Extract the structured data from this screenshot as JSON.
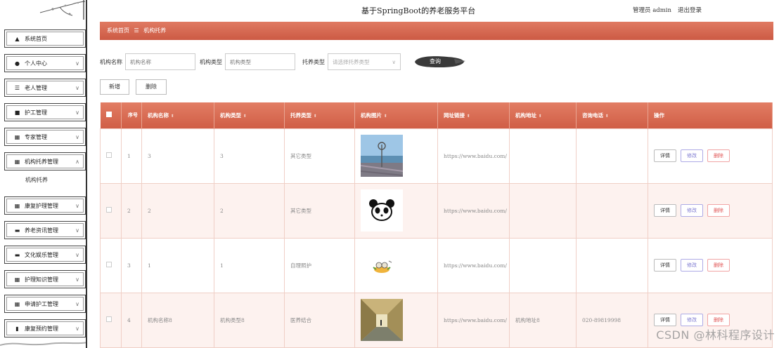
{
  "header": {
    "title": "基于SpringBoot的养老服务平台",
    "user": "管理员 admin",
    "logout": "退出登录"
  },
  "breadcrumb": {
    "home": "系统首页",
    "sep": "☰",
    "current": "机构托养"
  },
  "sidebar": {
    "items": [
      {
        "label": "系统首页",
        "icon": "home-icon",
        "chev": false
      },
      {
        "label": "个人中心",
        "icon": "user-icon",
        "chev": true
      },
      {
        "label": "老人管理",
        "icon": "list-icon",
        "chev": true
      },
      {
        "label": "护工管理",
        "icon": "clipboard-icon",
        "chev": true
      },
      {
        "label": "专家管理",
        "icon": "grid-icon",
        "chev": true
      },
      {
        "label": "机构托养管理",
        "icon": "grid-icon",
        "chev": true,
        "expanded": true
      }
    ],
    "sub_item": "机构托养",
    "items2": [
      {
        "label": "康复护理管理",
        "icon": "grid-icon"
      },
      {
        "label": "养老资讯管理",
        "icon": "monitor-icon"
      },
      {
        "label": "文化娱乐管理",
        "icon": "monitor-icon"
      },
      {
        "label": "护理知识管理",
        "icon": "grid-icon"
      },
      {
        "label": "申请护工管理",
        "icon": "grid-icon"
      },
      {
        "label": "康复预约管理",
        "icon": "bar-chart-icon"
      }
    ]
  },
  "search": {
    "name_label": "机构名称",
    "name_placeholder": "机构名称",
    "type_label": "机构类型",
    "type_placeholder": "机构类型",
    "care_label": "托养类型",
    "care_placeholder": "请选择托养类型",
    "query_label": "查询"
  },
  "actions": {
    "add": "新增",
    "delete": "删除"
  },
  "table": {
    "headers": [
      "序号",
      "机构名称",
      "机构类型",
      "托养类型",
      "机构图片",
      "网址链接",
      "机构地址",
      "咨询电话",
      "操作"
    ],
    "rows": [
      {
        "no": "1",
        "name": "3",
        "type": "3",
        "care": "其它类型",
        "image": "seaside-photo",
        "url": "https://www.baidu.com/",
        "addr": "",
        "phone": ""
      },
      {
        "no": "2",
        "name": "2",
        "type": "2",
        "care": "其它类型",
        "image": "panda-icon",
        "url": "https://www.baidu.com/",
        "addr": "",
        "phone": ""
      },
      {
        "no": "3",
        "name": "1",
        "type": "1",
        "care": "自理照护",
        "image": "cartoon-icon",
        "url": "https://www.baidu.com/",
        "addr": "",
        "phone": ""
      },
      {
        "no": "4",
        "name": "机构名称8",
        "type": "机构类型8",
        "care": "医养结合",
        "image": "corridor-photo",
        "url": "https://www.baidu.com/",
        "addr": "机构地址8",
        "phone": "020-89819998"
      }
    ],
    "op_view": "详情",
    "op_edit": "修改",
    "op_delete": "删除"
  },
  "watermark": "CSDN @林科程序设计"
}
